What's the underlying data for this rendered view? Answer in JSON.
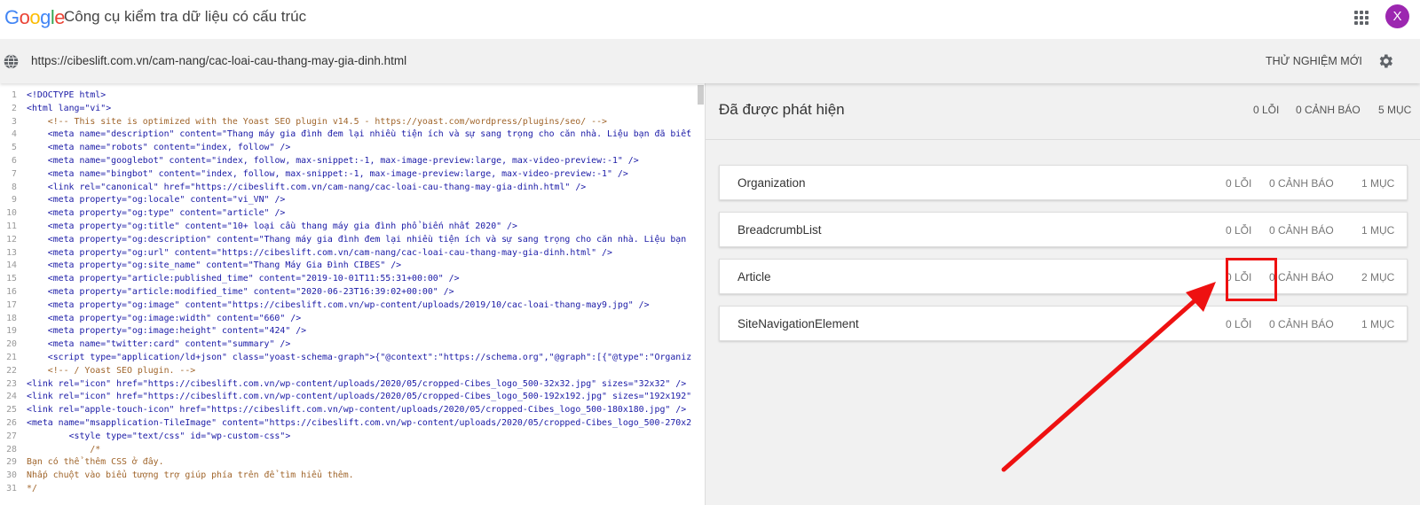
{
  "header": {
    "logo": "Google",
    "title": "Công cụ kiểm tra dữ liệu có cấu trúc",
    "avatar_letter": "X"
  },
  "urlbar": {
    "url": "https://cibeslift.com.vn/cam-nang/cac-loai-cau-thang-may-gia-dinh.html",
    "new_test_label": "THỬ NGHIỆM MỚI"
  },
  "code_lines": [
    {
      "n": "1",
      "indent": 0,
      "text": "<!DOCTYPE html>"
    },
    {
      "n": "2",
      "indent": 0,
      "text": "<html lang=\"vi\">"
    },
    {
      "n": "3",
      "indent": 1,
      "text": "<!-- This site is optimized with the Yoast SEO plugin v14.5 - https://yoast.com/wordpress/plugins/seo/ -->"
    },
    {
      "n": "4",
      "indent": 1,
      "text": "<meta name=\"description\" content=\"Thang máy gia đình đem lại nhiều tiện ích và sự sang trọng cho căn nhà. Liệu bạn đã biết"
    },
    {
      "n": "5",
      "indent": 1,
      "text": "<meta name=\"robots\" content=\"index, follow\" />"
    },
    {
      "n": "6",
      "indent": 1,
      "text": "<meta name=\"googlebot\" content=\"index, follow, max-snippet:-1, max-image-preview:large, max-video-preview:-1\" />"
    },
    {
      "n": "7",
      "indent": 1,
      "text": "<meta name=\"bingbot\" content=\"index, follow, max-snippet:-1, max-image-preview:large, max-video-preview:-1\" />"
    },
    {
      "n": "8",
      "indent": 1,
      "text": "<link rel=\"canonical\" href=\"https://cibeslift.com.vn/cam-nang/cac-loai-cau-thang-may-gia-dinh.html\" />"
    },
    {
      "n": "9",
      "indent": 1,
      "text": "<meta property=\"og:locale\" content=\"vi_VN\" />"
    },
    {
      "n": "10",
      "indent": 1,
      "text": "<meta property=\"og:type\" content=\"article\" />"
    },
    {
      "n": "11",
      "indent": 1,
      "text": "<meta property=\"og:title\" content=\"10+ loại cầu thang máy gia đình phổ biến nhất 2020\" />"
    },
    {
      "n": "12",
      "indent": 1,
      "text": "<meta property=\"og:description\" content=\"Thang máy gia đình đem lại nhiều tiện ích và sự sang trọng cho căn nhà. Liệu bạn"
    },
    {
      "n": "13",
      "indent": 1,
      "text": "<meta property=\"og:url\" content=\"https://cibeslift.com.vn/cam-nang/cac-loai-cau-thang-may-gia-dinh.html\" />"
    },
    {
      "n": "14",
      "indent": 1,
      "text": "<meta property=\"og:site_name\" content=\"Thang Máy Gia Đình CIBES\" />"
    },
    {
      "n": "15",
      "indent": 1,
      "text": "<meta property=\"article:published_time\" content=\"2019-10-01T11:55:31+00:00\" />"
    },
    {
      "n": "16",
      "indent": 1,
      "text": "<meta property=\"article:modified_time\" content=\"2020-06-23T16:39:02+00:00\" />"
    },
    {
      "n": "17",
      "indent": 1,
      "text": "<meta property=\"og:image\" content=\"https://cibeslift.com.vn/wp-content/uploads/2019/10/cac-loai-thang-may9.jpg\" />"
    },
    {
      "n": "18",
      "indent": 1,
      "text": "<meta property=\"og:image:width\" content=\"660\" />"
    },
    {
      "n": "19",
      "indent": 1,
      "text": "<meta property=\"og:image:height\" content=\"424\" />"
    },
    {
      "n": "20",
      "indent": 1,
      "text": "<meta name=\"twitter:card\" content=\"summary\" />"
    },
    {
      "n": "21",
      "indent": 1,
      "text": "<script type=\"application/ld+json\" class=\"yoast-schema-graph\">{\"@context\":\"https://schema.org\",\"@graph\":[{\"@type\":\"Organiz"
    },
    {
      "n": "22",
      "indent": 1,
      "text": "<!-- / Yoast SEO plugin. -->"
    },
    {
      "n": "23",
      "indent": 0,
      "text": "<link rel=\"icon\" href=\"https://cibeslift.com.vn/wp-content/uploads/2020/05/cropped-Cibes_logo_500-32x32.jpg\" sizes=\"32x32\" />"
    },
    {
      "n": "24",
      "indent": 0,
      "text": "<link rel=\"icon\" href=\"https://cibeslift.com.vn/wp-content/uploads/2020/05/cropped-Cibes_logo_500-192x192.jpg\" sizes=\"192x192\""
    },
    {
      "n": "25",
      "indent": 0,
      "text": "<link rel=\"apple-touch-icon\" href=\"https://cibeslift.com.vn/wp-content/uploads/2020/05/cropped-Cibes_logo_500-180x180.jpg\" />"
    },
    {
      "n": "26",
      "indent": 0,
      "text": "<meta name=\"msapplication-TileImage\" content=\"https://cibeslift.com.vn/wp-content/uploads/2020/05/cropped-Cibes_logo_500-270x2"
    },
    {
      "n": "27",
      "indent": 2,
      "text": "<style type=\"text/css\" id=\"wp-custom-css\">"
    },
    {
      "n": "28",
      "indent": 3,
      "text": "/*"
    },
    {
      "n": "29",
      "indent": 0,
      "text": "Bạn có thể thêm CSS ở đây."
    },
    {
      "n": "30",
      "indent": 0,
      "text": "Nhấp chuột vào biểu tượng trợ giúp phía trên để tìm hiểu thêm."
    },
    {
      "n": "31",
      "indent": 0,
      "text": "*/"
    }
  ],
  "results": {
    "title": "Đã được phát hiện",
    "errors": "0 LỖI",
    "warnings": "0 CẢNH BÁO",
    "items": "5 MỤC",
    "cards": [
      {
        "name": "Organization",
        "errors": "0 LỖI",
        "warnings": "0 CẢNH BÁO",
        "items": "1 MỤC"
      },
      {
        "name": "BreadcrumbList",
        "errors": "0 LỖI",
        "warnings": "0 CẢNH BÁO",
        "items": "1 MỤC"
      },
      {
        "name": "Article",
        "errors": "0 LỖI",
        "warnings": "0 CẢNH BÁO",
        "items": "2 MỤC"
      },
      {
        "name": "SiteNavigationElement",
        "errors": "0 LỖI",
        "warnings": "0 CẢNH BÁO",
        "items": "1 MỤC"
      }
    ]
  },
  "colors": {
    "accent_red": "#ee1111",
    "avatar": "#9c27b0",
    "tag": "#1a1aa6",
    "attr": "#d00000",
    "value": "#22863a",
    "comment": "#a0652b"
  }
}
